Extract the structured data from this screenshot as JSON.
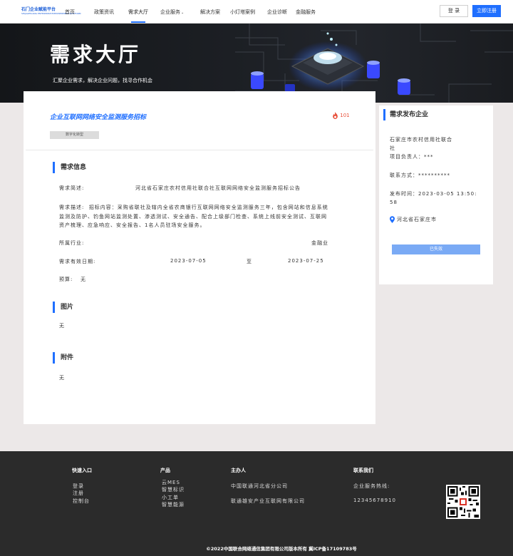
{
  "header": {
    "logo_line1": "石门企业赋能平台",
    "logo_line2": "SHIJIAZHUANG ENTERPRISE EMPOWERMENT PLATFORM",
    "nav": [
      "首页",
      "政策资讯",
      "需求大厅",
      "企业服务",
      "解决方案",
      "小灯塔案例",
      "企业诊断",
      "金融服务"
    ],
    "login_label": "登 录",
    "register_label": "立即注册",
    "accent": "#1f6fff"
  },
  "banner": {
    "title": "需求大厅",
    "subtitle": "汇聚企业需求，解决企业问题，找寻合作机会"
  },
  "demand": {
    "title": "企业互联网网络安全监测服务招标",
    "hot_count": "101",
    "tag": "数字化转型",
    "info_heading": "需求信息",
    "brief_label": "需求简述:",
    "brief_value": "河北省石家庄农村信用社联合社互联网网络安全监测服务招标公告",
    "desc_label": "需求描述:",
    "desc_value": "招标内容：采购省联社及辖内全省农商银行互联网网络安全监测服务三年，包含网站和信息系统监测及防护、钓鱼网站监测处置、渗透测试、安全通告、配合上级部门检查、系统上线前安全测试、互联网资产梳理、应急响应、安全报告、1名人员驻场安全服务。",
    "industry_label": "所属行业:",
    "industry_value": "金融业",
    "valid_label": "需求有效日期:",
    "valid_from": "2023-07-05",
    "valid_to_sep": "至",
    "valid_to": "2023-07-25",
    "budget_label": "预算:",
    "budget_value": "无",
    "pictures_heading": "图片",
    "pictures_value": "无",
    "attachments_heading": "附件",
    "attachments_value": "无"
  },
  "publisher": {
    "heading": "需求发布企业",
    "company_line1": "石家庄市农村信用社联合",
    "company_line2": "社",
    "contact_person": "项目负责人：***",
    "contact_method": "联系方式：**********",
    "publish_time_line1": "发布时间：2023-03-05 13:50:",
    "publish_time_line2": "58",
    "location": "河北省石家庄市",
    "status_button": "已失效"
  },
  "footer": {
    "quick_heading": "快速入口",
    "quick_links": [
      "登录",
      "注册",
      "控制台"
    ],
    "product_heading": "产品",
    "products": [
      "云MES",
      "智慧标识",
      "小工单",
      "智慧能源"
    ],
    "host_heading": "主办人",
    "hosts": [
      "中国联通河北省分公司",
      "联通雄安产业互联网有限公司"
    ],
    "contact_heading": "联系我们",
    "hotline_label": "企业服务热线:",
    "hotline": "12345678910",
    "copyright": "©2022中国联合网络通信集团有限公司版本所有  冀ICP备17109783号"
  }
}
